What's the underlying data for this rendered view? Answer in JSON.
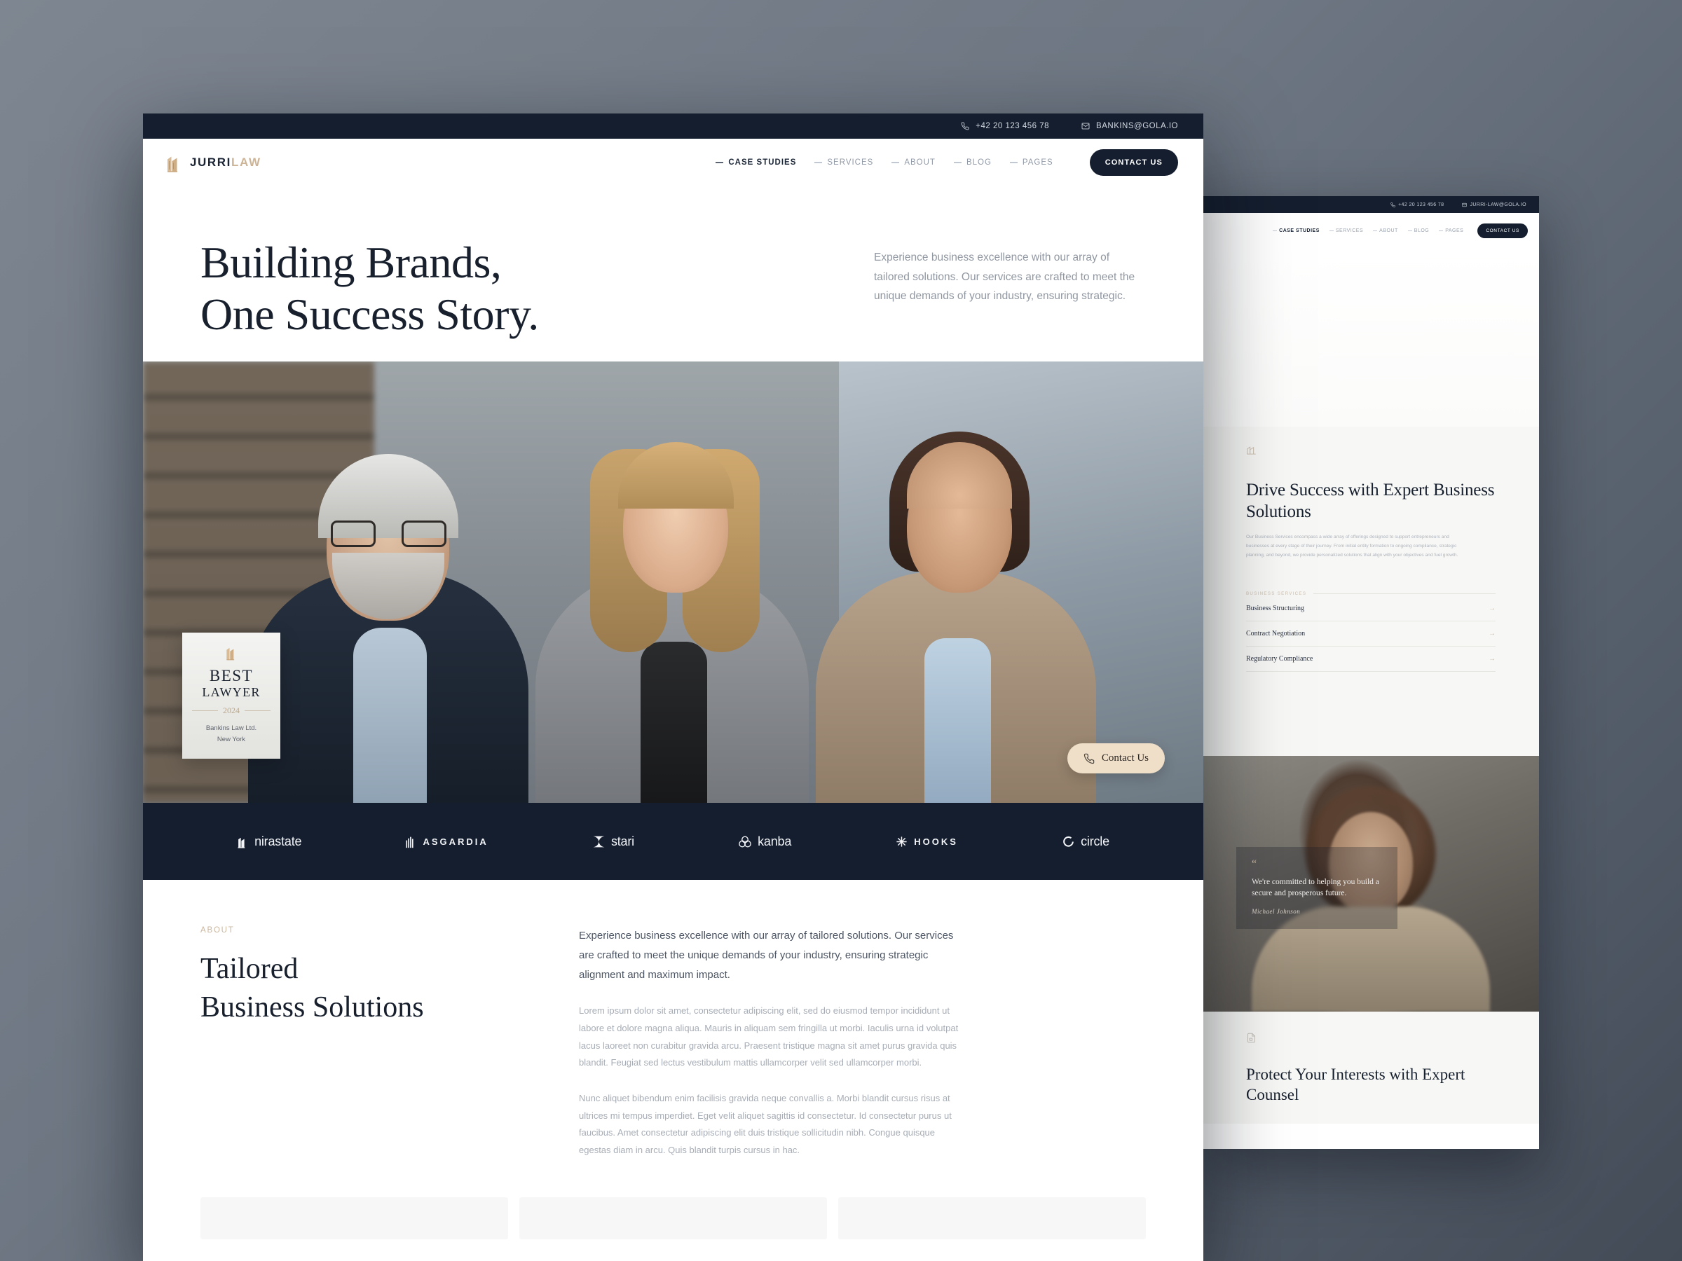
{
  "back_window": {
    "topbar": {
      "phone": "+42 20 123 456 78",
      "email": "JURRI-LAW@GOLA.IO"
    },
    "nav": {
      "items": [
        "CASE STUDIES",
        "SERVICES",
        "ABOUT",
        "BLOG",
        "PAGES"
      ],
      "cta": "CONTACT US"
    },
    "services_section": {
      "heading": "Drive Success with Expert Business Solutions",
      "paragraph": "Our Business Services encompass a wide array of offerings designed to support entrepreneurs and businesses at every stage of their journey. From initial entity formation to ongoing compliance, strategic planning, and beyond, we provide personalized solutions that align with your objectives and fuel growth.",
      "label": "BUSINESS SERVICES",
      "items": [
        "Business Structuring",
        "Contract Negotiation",
        "Regulatory Compliance"
      ],
      "arrow": "→"
    },
    "testimonial": {
      "quote_mark": "“",
      "quote": "We're committed to helping you build a secure and prosperous future.",
      "author": "Michael Johnson"
    },
    "bottom_section": {
      "heading": "Protect Your Interests with Expert Counsel"
    }
  },
  "front_window": {
    "topbar": {
      "phone": "+42 20 123 456 78",
      "email": "BANKINS@GOLA.IO"
    },
    "logo": {
      "part1": "JURRI",
      "part2": "LAW"
    },
    "nav": {
      "items": [
        "CASE STUDIES",
        "SERVICES",
        "ABOUT",
        "BLOG",
        "PAGES"
      ],
      "cta": "CONTACT US"
    },
    "hero": {
      "title_line1": "Building Brands,",
      "title_line2": "One Success Story.",
      "paragraph": "Experience business excellence with our array of tailored solutions. Our services are crafted to meet the unique demands of your industry, ensuring strategic."
    },
    "badge": {
      "title_line1": "BEST",
      "title_line2": "LAWYER",
      "year": "2024",
      "firm": "Bankins Law Ltd.",
      "city": "New York"
    },
    "contact_pill": {
      "label": "Contact Us"
    },
    "logo_strip": [
      {
        "name": "nirastate",
        "icon": "building-icon",
        "style": "normal"
      },
      {
        "name": "ASGARDIA",
        "icon": "bars-icon",
        "style": "spaced"
      },
      {
        "name": "stari",
        "icon": "star-burst-icon",
        "style": "normal"
      },
      {
        "name": "kanba",
        "icon": "venn-icon",
        "style": "normal"
      },
      {
        "name": "HOOKS",
        "icon": "asterisk-icon",
        "style": "spaced"
      },
      {
        "name": "circle",
        "icon": "circle-icon",
        "style": "normal"
      }
    ],
    "about": {
      "eyebrow": "ABOUT",
      "heading_line1": "Tailored",
      "heading_line2": "Business Solutions",
      "lead": "Experience business excellence with our array of tailored solutions. Our services are crafted to meet the unique demands of your industry, ensuring strategic alignment and maximum impact.",
      "paragraph1": "Lorem ipsum dolor sit amet, consectetur adipiscing elit, sed do eiusmod tempor incididunt ut labore et dolore magna aliqua. Mauris in aliquam sem fringilla ut morbi. Iaculis urna id volutpat lacus laoreet non curabitur gravida arcu. Praesent tristique magna sit amet purus gravida quis blandit. Feugiat sed lectus vestibulum mattis ullamcorper velit sed ullamcorper morbi.",
      "paragraph2": "Nunc aliquet bibendum enim facilisis gravida neque convallis a. Morbi blandit cursus risus at ultrices mi tempus imperdiet. Eget velit aliquet sagittis id consectetur. Id consectetur purus ut faucibus. Amet consectetur adipiscing elit duis tristique sollicitudin nibh. Congue quisque egestas diam in arcu. Quis blandit turpis cursus in hac."
    }
  },
  "colors": {
    "navy": "#141e2e",
    "tan": "#cdb496",
    "beige_pill": "#f0dfc8",
    "muted_text": "#9097a1"
  }
}
